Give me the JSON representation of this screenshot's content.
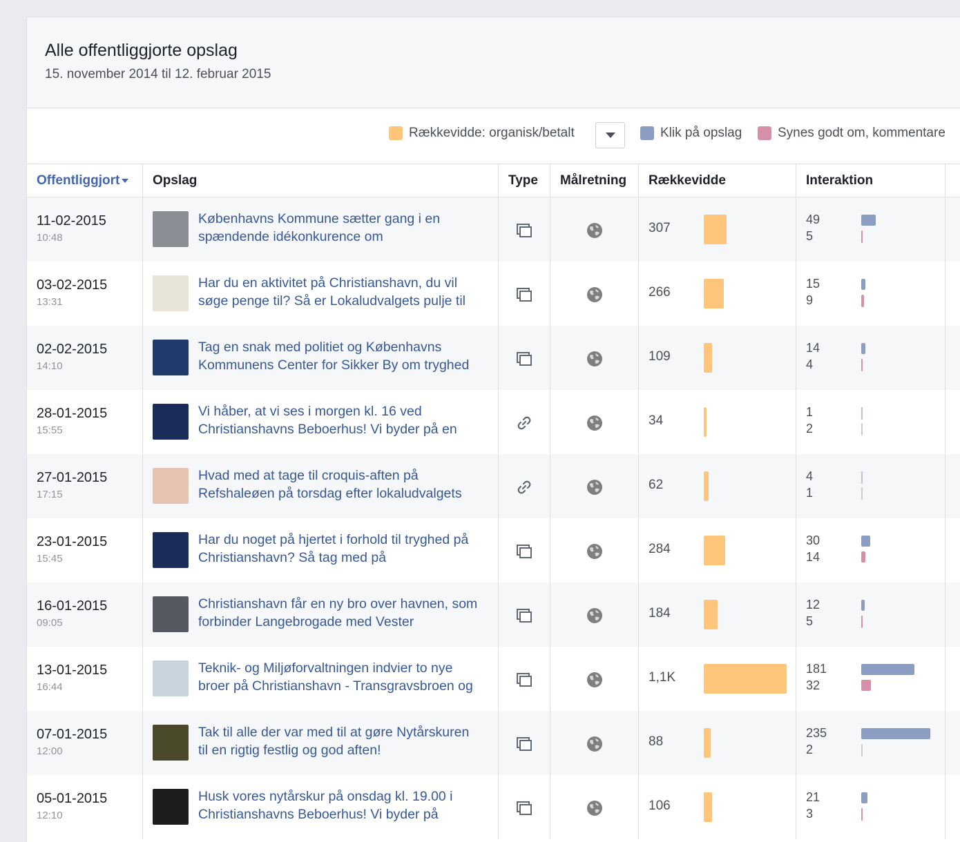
{
  "header": {
    "title": "Alle offentliggjorte opslag",
    "date_range": "15. november 2014 til 12. februar 2015"
  },
  "legend": {
    "reach_label": "Rækkevidde: organisk/betalt",
    "clicks_label": "Klik på opslag",
    "likes_label": "Synes godt om, kommentare",
    "colors": {
      "reach": "#ffc57a",
      "clicks": "#8b9dc3",
      "likes": "#d68fa8"
    }
  },
  "columns": {
    "published": "Offentliggjort",
    "post": "Opslag",
    "type": "Type",
    "targeting": "Målretning",
    "reach": "Rækkevidde",
    "interaction": "Interaktion"
  },
  "rows": [
    {
      "date": "11-02-2015",
      "time": "10:48",
      "text1": "Københavns Kommune sætter gang i en",
      "text2": "spændende idékonkurence om",
      "type": "post-icon",
      "target": "globe-icon",
      "reach": "307",
      "reach_value": 307,
      "clicks": "49",
      "likes": "5",
      "clicks_value": 49,
      "likes_value": 5,
      "thumb": "#8a8f95"
    },
    {
      "date": "03-02-2015",
      "time": "13:31",
      "text1": "Har du en aktivitet på Christianshavn, du vil",
      "text2": "søge penge til? Så er Lokaludvalgets pulje til",
      "type": "post-icon",
      "target": "globe-icon",
      "reach": "266",
      "reach_value": 266,
      "clicks": "15",
      "likes": "9",
      "clicks_value": 15,
      "likes_value": 9,
      "thumb": "#e8e4d8"
    },
    {
      "date": "02-02-2015",
      "time": "14:10",
      "text1": "Tag en snak med politiet og Københavns",
      "text2": "Kommunens Center for Sikker By om tryghed",
      "type": "post-icon",
      "target": "globe-icon",
      "reach": "109",
      "reach_value": 109,
      "clicks": "14",
      "likes": "4",
      "clicks_value": 14,
      "likes_value": 4,
      "thumb": "#1f3a6b"
    },
    {
      "date": "28-01-2015",
      "time": "15:55",
      "text1": "Vi håber, at vi ses i morgen kl. 16 ved",
      "text2": "Christianshavns Beboerhus! Vi byder på en",
      "type": "link-icon",
      "target": "globe-icon",
      "reach": "34",
      "reach_value": 34,
      "clicks": "1",
      "likes": "2",
      "clicks_value": 1,
      "likes_value": 2,
      "thumb": "#1a2d5a"
    },
    {
      "date": "27-01-2015",
      "time": "17:15",
      "text1": "Hvad med at tage til croquis-aften på",
      "text2": "Refshaleøen på torsdag efter lokaludvalgets",
      "type": "link-icon",
      "target": "globe-icon",
      "reach": "62",
      "reach_value": 62,
      "clicks": "4",
      "likes": "1",
      "clicks_value": 4,
      "likes_value": 1,
      "thumb": "#e6c2b0"
    },
    {
      "date": "23-01-2015",
      "time": "15:45",
      "text1": "Har du noget på hjertet i forhold til tryghed på",
      "text2": "Christianshavn? Så tag med på",
      "type": "post-icon",
      "target": "globe-icon",
      "reach": "284",
      "reach_value": 284,
      "clicks": "30",
      "likes": "14",
      "clicks_value": 30,
      "likes_value": 14,
      "thumb": "#1a2d5a"
    },
    {
      "date": "16-01-2015",
      "time": "09:05",
      "text1": "Christianshavn får en ny bro over havnen, som",
      "text2": "forbinder Langebrogade med Vester",
      "type": "post-icon",
      "target": "globe-icon",
      "reach": "184",
      "reach_value": 184,
      "clicks": "12",
      "likes": "5",
      "clicks_value": 12,
      "likes_value": 5,
      "thumb": "#555a60"
    },
    {
      "date": "13-01-2015",
      "time": "16:44",
      "text1": "Teknik- og Miljøforvaltningen indvier to nye",
      "text2": "broer på Christianshavn - Transgravsbroen og",
      "type": "post-icon",
      "target": "globe-icon",
      "reach": "1,1K",
      "reach_value": 1100,
      "clicks": "181",
      "likes": "32",
      "clicks_value": 181,
      "likes_value": 32,
      "thumb": "#c9d3dc"
    },
    {
      "date": "07-01-2015",
      "time": "12:00",
      "text1": "Tak til alle der var med til at gøre Nytårskuren",
      "text2": "til en rigtig festlig og god aften!",
      "type": "post-icon",
      "target": "globe-icon",
      "reach": "88",
      "reach_value": 88,
      "clicks": "235",
      "likes": "2",
      "clicks_value": 235,
      "likes_value": 2,
      "thumb": "#4a4a2a"
    },
    {
      "date": "05-01-2015",
      "time": "12:10",
      "text1": "Husk vores nytårskur på onsdag kl. 19.00 i",
      "text2": "Christianshavns Beboerhus! Vi byder på",
      "type": "post-icon",
      "target": "globe-icon",
      "reach": "106",
      "reach_value": 106,
      "clicks": "21",
      "likes": "3",
      "clicks_value": 21,
      "likes_value": 3,
      "thumb": "#1d1d1d"
    }
  ]
}
